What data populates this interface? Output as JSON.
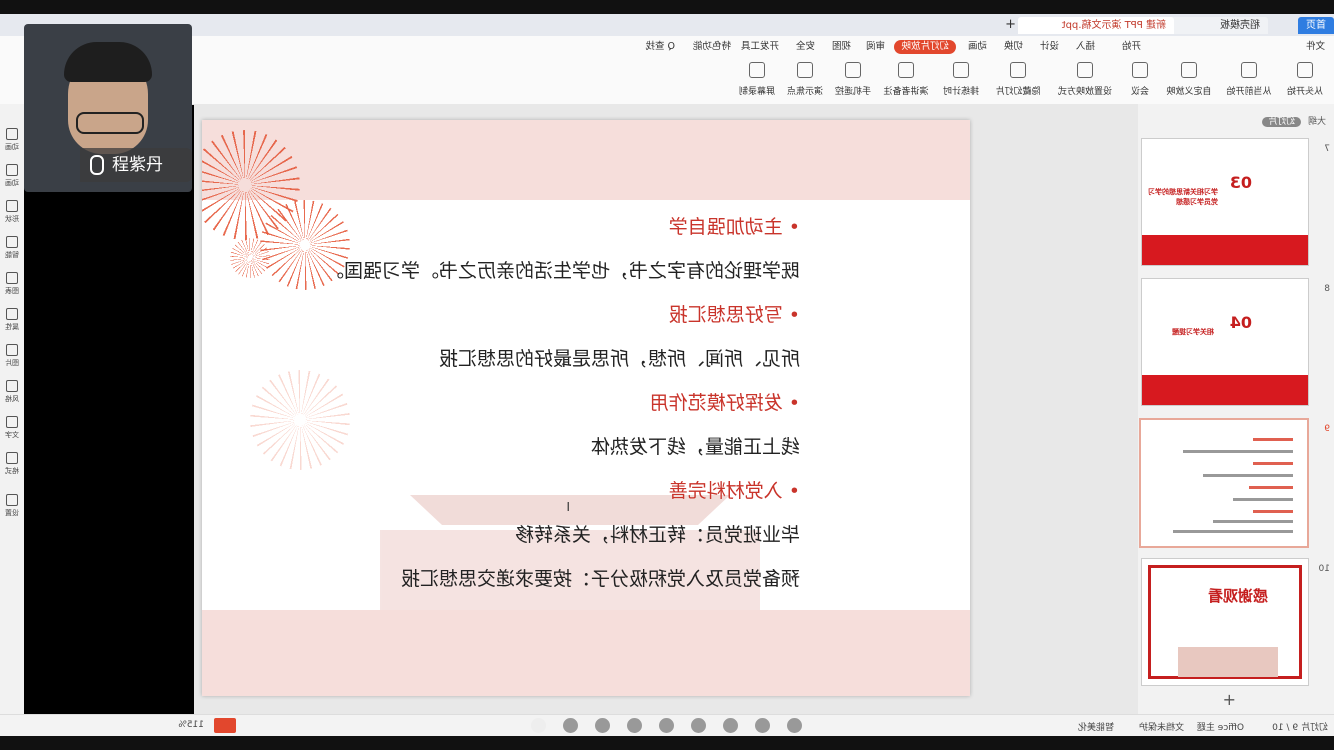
{
  "tabs": {
    "home": "首页",
    "templates": "稻壳模板",
    "document": "新建 PPT 演示文稿.ppt"
  },
  "menu": {
    "file": "文件",
    "start": "开始",
    "insert": "插入",
    "design": "设计",
    "transition": "切换",
    "animation": "动画",
    "slideshow": "幻灯片放映",
    "review": "审阅",
    "view": "视图",
    "security": "安全",
    "developer": "开发工具",
    "special": "特色功能",
    "search": "Q 查找"
  },
  "toolbar": [
    "从头开始",
    "从当前开始",
    "自定义放映",
    "会议",
    "设置放映方式",
    "隐藏幻灯片",
    "排练计时",
    "演讲者备注",
    "手机遥控",
    "演示焦点",
    "屏幕录制"
  ],
  "thumbnails": {
    "header": "大纲",
    "header_pill": "幻灯片",
    "slides": [
      {
        "num": "7",
        "number_text": "03",
        "title_line1": "学习相关新思想的学习",
        "title_line2": "党员学习感想"
      },
      {
        "num": "8",
        "number_text": "04",
        "title_line1": "相关学习提醒"
      },
      {
        "num": "9"
      },
      {
        "num": "10",
        "end_text": "感谢观看"
      }
    ]
  },
  "slide": {
    "items": [
      {
        "heading": "主动加强自学",
        "body": "既学理论的有字之书，也学生活的亲历之书。学习强国。"
      },
      {
        "heading": "写好思想汇报",
        "body": "所见、所闻、所想，所思是最好的思想汇报"
      },
      {
        "heading": "发挥好模范作用",
        "body": "线上正能量，线下发热体"
      },
      {
        "heading": "入党材料完善",
        "body": "毕业班党员：转正材料，关系转移"
      },
      {
        "heading": "",
        "body": "预备党员及入党积极分子：按要求递交思想汇报"
      }
    ],
    "bullet": "•"
  },
  "video": {
    "name": "程紫丹"
  },
  "sidetools": [
    "动画",
    "动画",
    "形状",
    "智能",
    "图表",
    "属性",
    "图片",
    "风格",
    "文字",
    "格式",
    "设置"
  ],
  "status": {
    "slide_count": "幻灯片 9 / 10",
    "theme": "Office 主题",
    "doc_status": "文档未保护",
    "smart": "智能美化",
    "zoom": "115%"
  },
  "colors": {
    "accent": "#e2472d",
    "slide_red": "#c9342b",
    "slide_pink": "#f6dedb"
  }
}
